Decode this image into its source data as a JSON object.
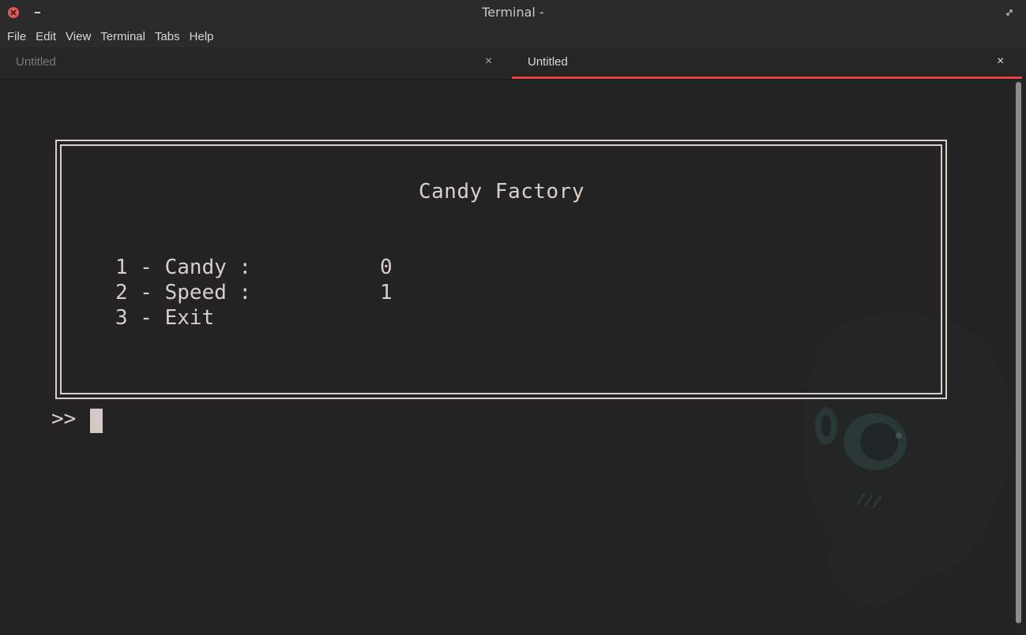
{
  "window": {
    "title": "Terminal -"
  },
  "menu": [
    "File",
    "Edit",
    "View",
    "Terminal",
    "Tabs",
    "Help"
  ],
  "tabs": [
    {
      "label": "Untitled",
      "active": false,
      "close": "×"
    },
    {
      "label": "Untitled",
      "active": true,
      "close": "×"
    }
  ],
  "terminal": {
    "box_title": "Candy Factory",
    "options": [
      {
        "label": "1 - Candy :",
        "value": "0"
      },
      {
        "label": "2 - Speed :",
        "value": "1"
      },
      {
        "label": "3 - Exit",
        "value": ""
      }
    ],
    "prompt": ">>"
  },
  "colors": {
    "accent": "#e5423c",
    "close_button": "#e0565b",
    "terminal_text": "#d9cfc9",
    "background": "#232323"
  },
  "icons": {
    "close": "close-icon",
    "minimize": "minimize-icon",
    "restore": "restore-icon",
    "background": "mascot-watermark"
  }
}
